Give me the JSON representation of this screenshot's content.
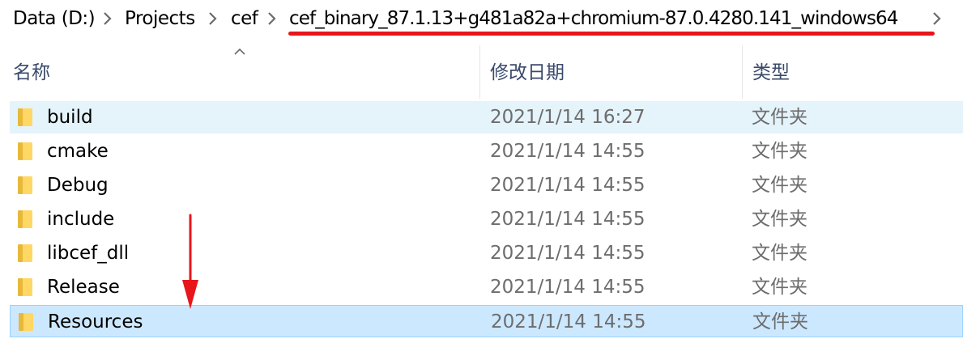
{
  "breadcrumb": {
    "items": [
      "Data (D:)",
      "Projects",
      "cef",
      "cef_binary_87.1.13+g481a82a+chromium-87.0.4280.141_windows64"
    ]
  },
  "columns": {
    "name": "名称",
    "date": "修改日期",
    "type": "类型"
  },
  "files": [
    {
      "name": "build",
      "date": "2021/1/14 16:27",
      "type": "文件夹",
      "state": "hover"
    },
    {
      "name": "cmake",
      "date": "2021/1/14 14:55",
      "type": "文件夹",
      "state": "normal"
    },
    {
      "name": "Debug",
      "date": "2021/1/14 14:55",
      "type": "文件夹",
      "state": "normal"
    },
    {
      "name": "include",
      "date": "2021/1/14 14:55",
      "type": "文件夹",
      "state": "normal"
    },
    {
      "name": "libcef_dll",
      "date": "2021/1/14 14:55",
      "type": "文件夹",
      "state": "normal"
    },
    {
      "name": "Release",
      "date": "2021/1/14 14:55",
      "type": "文件夹",
      "state": "normal"
    },
    {
      "name": "Resources",
      "date": "2021/1/14 14:55",
      "type": "文件夹",
      "state": "selected"
    }
  ],
  "colors": {
    "selection_bg": "#cce8ff",
    "selection_border": "#99d1ff",
    "hover_bg": "#e5f3fb",
    "folder_yellow": "#ffd765",
    "annotation_red": "#e8151b",
    "header_text": "#3a4a6b"
  },
  "icons": {
    "breadcrumb_separator": "chevron-right-icon",
    "sort_indicator": "chevron-up-icon",
    "folder": "folder-icon"
  }
}
